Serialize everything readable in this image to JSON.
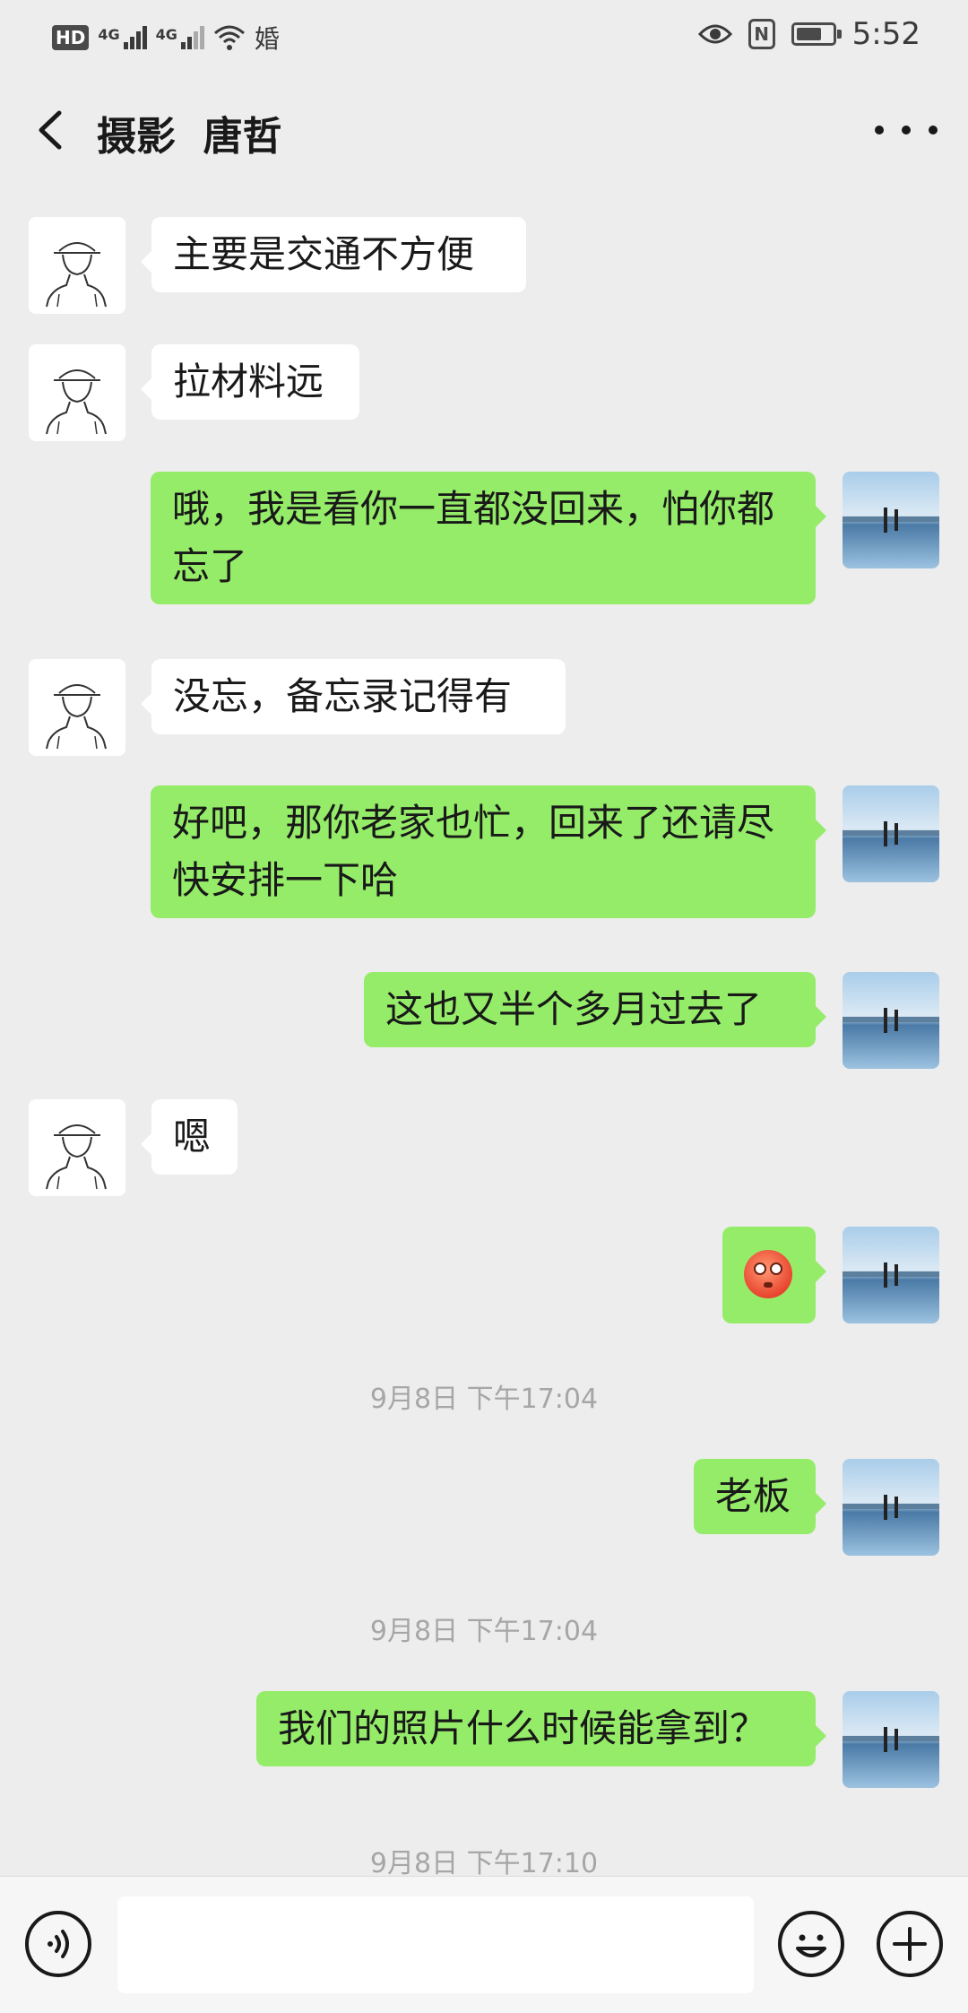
{
  "status_bar": {
    "hd": "HD",
    "net1": "4G",
    "net2": "4G",
    "extra": "婚",
    "nfc": "N",
    "time": "5:52"
  },
  "header": {
    "title": "摄影  唐哲"
  },
  "messages": [
    {
      "side": "left",
      "text": "主要是交通不方便"
    },
    {
      "side": "left",
      "text": "拉材料远"
    },
    {
      "side": "right",
      "text": "哦，我是看你一直都没回来，怕你都忘了"
    },
    {
      "side": "left",
      "text": "没忘，备忘录记得有"
    },
    {
      "side": "right",
      "text": "好吧，那你老家也忙，回来了还请尽快安排一下哈"
    },
    {
      "side": "right",
      "text": "这也又半个多月过去了"
    },
    {
      "side": "left",
      "text": "嗯"
    },
    {
      "side": "right",
      "emoji": "flushed-face-emoji"
    },
    {
      "side": "right",
      "text": "老板"
    },
    {
      "side": "right",
      "text": "我们的照片什么时候能拿到？"
    }
  ],
  "timestamps": [
    "9月8日 下午17:04",
    "9月8日 下午17:04",
    "9月8日 下午17:10"
  ],
  "input": {
    "value": ""
  }
}
